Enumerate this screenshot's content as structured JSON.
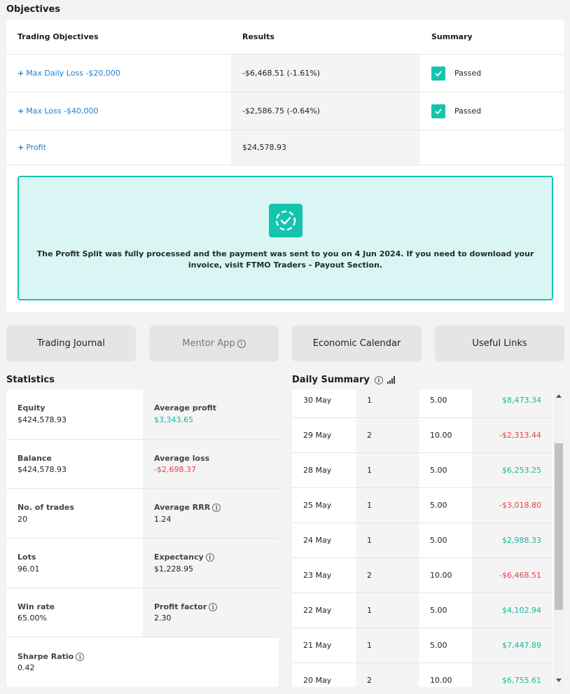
{
  "objectives": {
    "title": "Objectives",
    "headers": {
      "objective": "Trading Objectives",
      "results": "Results",
      "summary": "Summary"
    },
    "rows": [
      {
        "objective": "Max Daily Loss -$20,000",
        "result": "-$6,468.51 (-1.61%)",
        "summary": "Passed"
      },
      {
        "objective": "Max Loss -$40,000",
        "result": "-$2,586.75 (-0.64%)",
        "summary": "Passed"
      },
      {
        "objective": "Profit",
        "result": "$24,578.93",
        "summary": ""
      }
    ],
    "plus": "+",
    "notice": "The Profit Split was fully processed and the payment was sent to you on 4 Jun 2024. If you need to download your invoice, visit FTMO Traders - Payout Section."
  },
  "buttons": {
    "journal": "Trading Journal",
    "mentor": "Mentor App",
    "calendar": "Economic Calendar",
    "links": "Useful Links"
  },
  "info_glyph": "i",
  "statistics": {
    "title": "Statistics",
    "left": [
      {
        "label": "Equity",
        "value": "$424,578.93"
      },
      {
        "label": "Balance",
        "value": "$424,578.93"
      },
      {
        "label": "No. of trades",
        "value": "20"
      },
      {
        "label": "Lots",
        "value": "96.01"
      },
      {
        "label": "Win rate",
        "value": "65.00%"
      },
      {
        "label": "Sharpe Ratio",
        "value": "0.42"
      }
    ],
    "right": [
      {
        "label": "Average profit",
        "value": "$3,343.65"
      },
      {
        "label": "Average loss",
        "value": "-$2,698.37"
      },
      {
        "label": "Average RRR",
        "value": "1.24"
      },
      {
        "label": "Expectancy",
        "value": "$1,228.95"
      },
      {
        "label": "Profit factor",
        "value": "2.30"
      }
    ]
  },
  "daily": {
    "title": "Daily Summary",
    "rows": [
      {
        "date": "30 May",
        "trades": "1",
        "lots": "5.00",
        "result": "$8,473.34"
      },
      {
        "date": "29 May",
        "trades": "2",
        "lots": "10.00",
        "result": "-$2,313.44"
      },
      {
        "date": "28 May",
        "trades": "1",
        "lots": "5.00",
        "result": "$6,253.25"
      },
      {
        "date": "25 May",
        "trades": "1",
        "lots": "5.00",
        "result": "-$3,018.80"
      },
      {
        "date": "24 May",
        "trades": "1",
        "lots": "5.00",
        "result": "$2,988.33"
      },
      {
        "date": "23 May",
        "trades": "2",
        "lots": "10.00",
        "result": "-$6,468.51"
      },
      {
        "date": "22 May",
        "trades": "1",
        "lots": "5.00",
        "result": "$4,102.94"
      },
      {
        "date": "21 May",
        "trades": "1",
        "lots": "5.00",
        "result": "$7,447.89"
      },
      {
        "date": "20 May",
        "trades": "2",
        "lots": "10.00",
        "result": "$6,755.61"
      }
    ]
  },
  "colors": {
    "accent": "#14c5ad",
    "link": "#1a7fd6",
    "positive": "#14b89f",
    "negative": "#e3404f"
  }
}
